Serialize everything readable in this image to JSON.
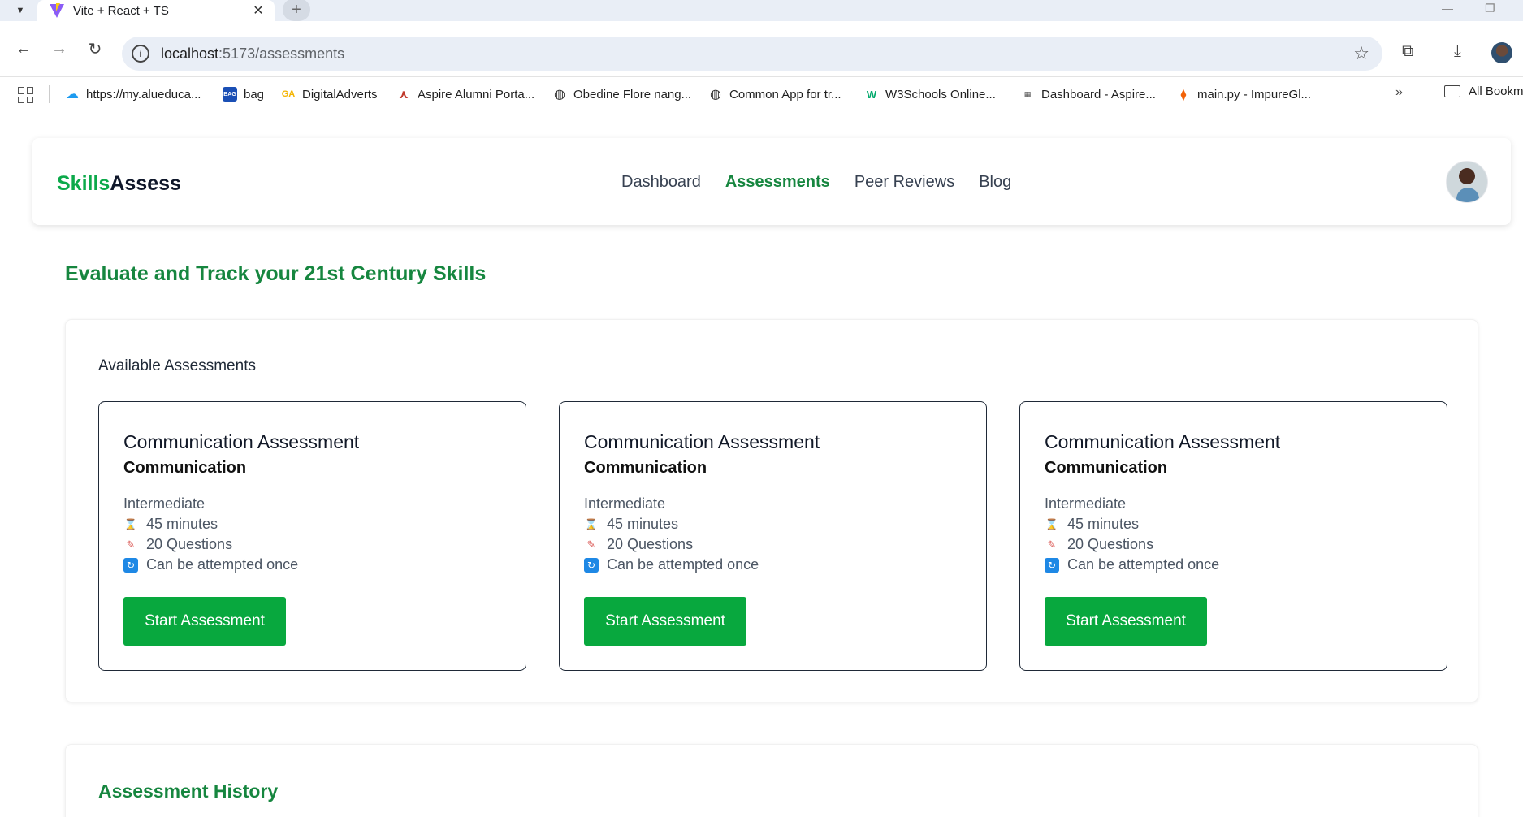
{
  "browser": {
    "tab_title": "Vite + React + TS",
    "url_host": "localhost",
    "url_path": ":5173/assessments",
    "bookmarks": [
      {
        "label": "https://my.alueduca...",
        "icon": "cloud-icon",
        "color": "#1d9bf0"
      },
      {
        "label": "bag",
        "icon": "bag-icon",
        "color": "#1a4fb5"
      },
      {
        "label": "DigitalAdverts",
        "icon": "ga-icon",
        "color": "#f4b400"
      },
      {
        "label": "Aspire Alumni Porta...",
        "icon": "aspire-icon",
        "color": "#c0392b"
      },
      {
        "label": "Obedine Flore nang...",
        "icon": "globe-icon",
        "color": "#333333"
      },
      {
        "label": "Common App for tr...",
        "icon": "globe-icon",
        "color": "#333333"
      },
      {
        "label": "W3Schools Online...",
        "icon": "w3schools-icon",
        "color": "#04aa6d"
      },
      {
        "label": "Dashboard - Aspire...",
        "icon": "dashboard-icon",
        "color": "#444444"
      },
      {
        "label": "main.py - ImpureGl...",
        "icon": "replit-icon",
        "color": "#f26207"
      }
    ],
    "all_bookmarks": "All Bookm"
  },
  "app": {
    "logo_part1": "Skills",
    "logo_part2": "Assess",
    "nav": [
      {
        "label": "Dashboard",
        "active": false
      },
      {
        "label": "Assessments",
        "active": true
      },
      {
        "label": "Peer Reviews",
        "active": false
      },
      {
        "label": "Blog",
        "active": false
      }
    ]
  },
  "main": {
    "heading": "Evaluate and Track your 21st Century Skills",
    "available_title": "Available Assessments",
    "history_title": "Assessment History",
    "cards": [
      {
        "title": "Communication Assessment",
        "category": "Communication",
        "level": "Intermediate",
        "duration": "45 minutes",
        "questions": "20 Questions",
        "attempts": "Can be attempted once",
        "button": "Start Assessment"
      },
      {
        "title": "Communication Assessment",
        "category": "Communication",
        "level": "Intermediate",
        "duration": "45 minutes",
        "questions": "20 Questions",
        "attempts": "Can be attempted once",
        "button": "Start Assessment"
      },
      {
        "title": "Communication Assessment",
        "category": "Communication",
        "level": "Intermediate",
        "duration": "45 minutes",
        "questions": "20 Questions",
        "attempts": "Can be attempted once",
        "button": "Start Assessment"
      }
    ]
  },
  "colors": {
    "brand_green": "#0ca94a",
    "heading_green": "#16863f",
    "button_green": "#08a83e"
  }
}
